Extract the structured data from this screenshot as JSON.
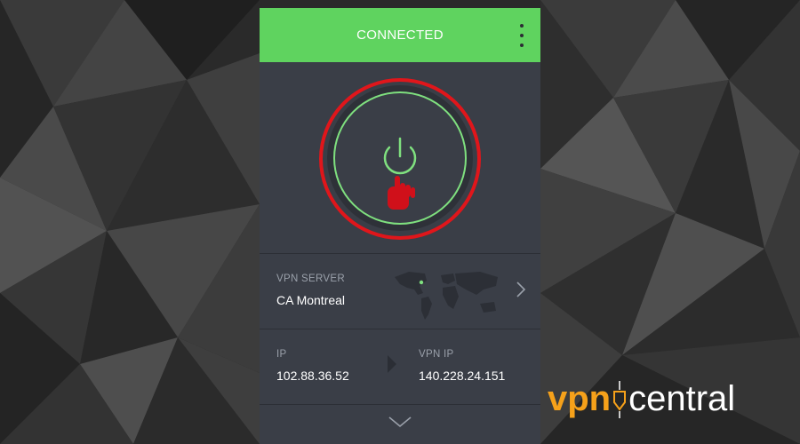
{
  "app": {
    "status": "CONNECTED",
    "menu_icon": "kebab-menu-icon",
    "power_icon": "power-icon",
    "cursor_icon": "hand-pointer-icon"
  },
  "server": {
    "label": "VPN SERVER",
    "value": "CA Montreal",
    "map_icon": "world-map-icon",
    "chevron_icon": "chevron-right-icon"
  },
  "ip": {
    "label": "IP",
    "value": "102.88.36.52",
    "vpn_label": "VPN IP",
    "vpn_value": "140.228.24.151",
    "arrow_icon": "triangle-right-icon"
  },
  "footer": {
    "expand_icon": "chevron-down-icon"
  },
  "brand": {
    "part1": "vpn",
    "part2": "central"
  },
  "colors": {
    "header": "#5fd35f",
    "panel": "#3a3e47",
    "ring": "#7fe07f",
    "highlight": "#e0161b",
    "brand_orange": "#f6a11a"
  }
}
